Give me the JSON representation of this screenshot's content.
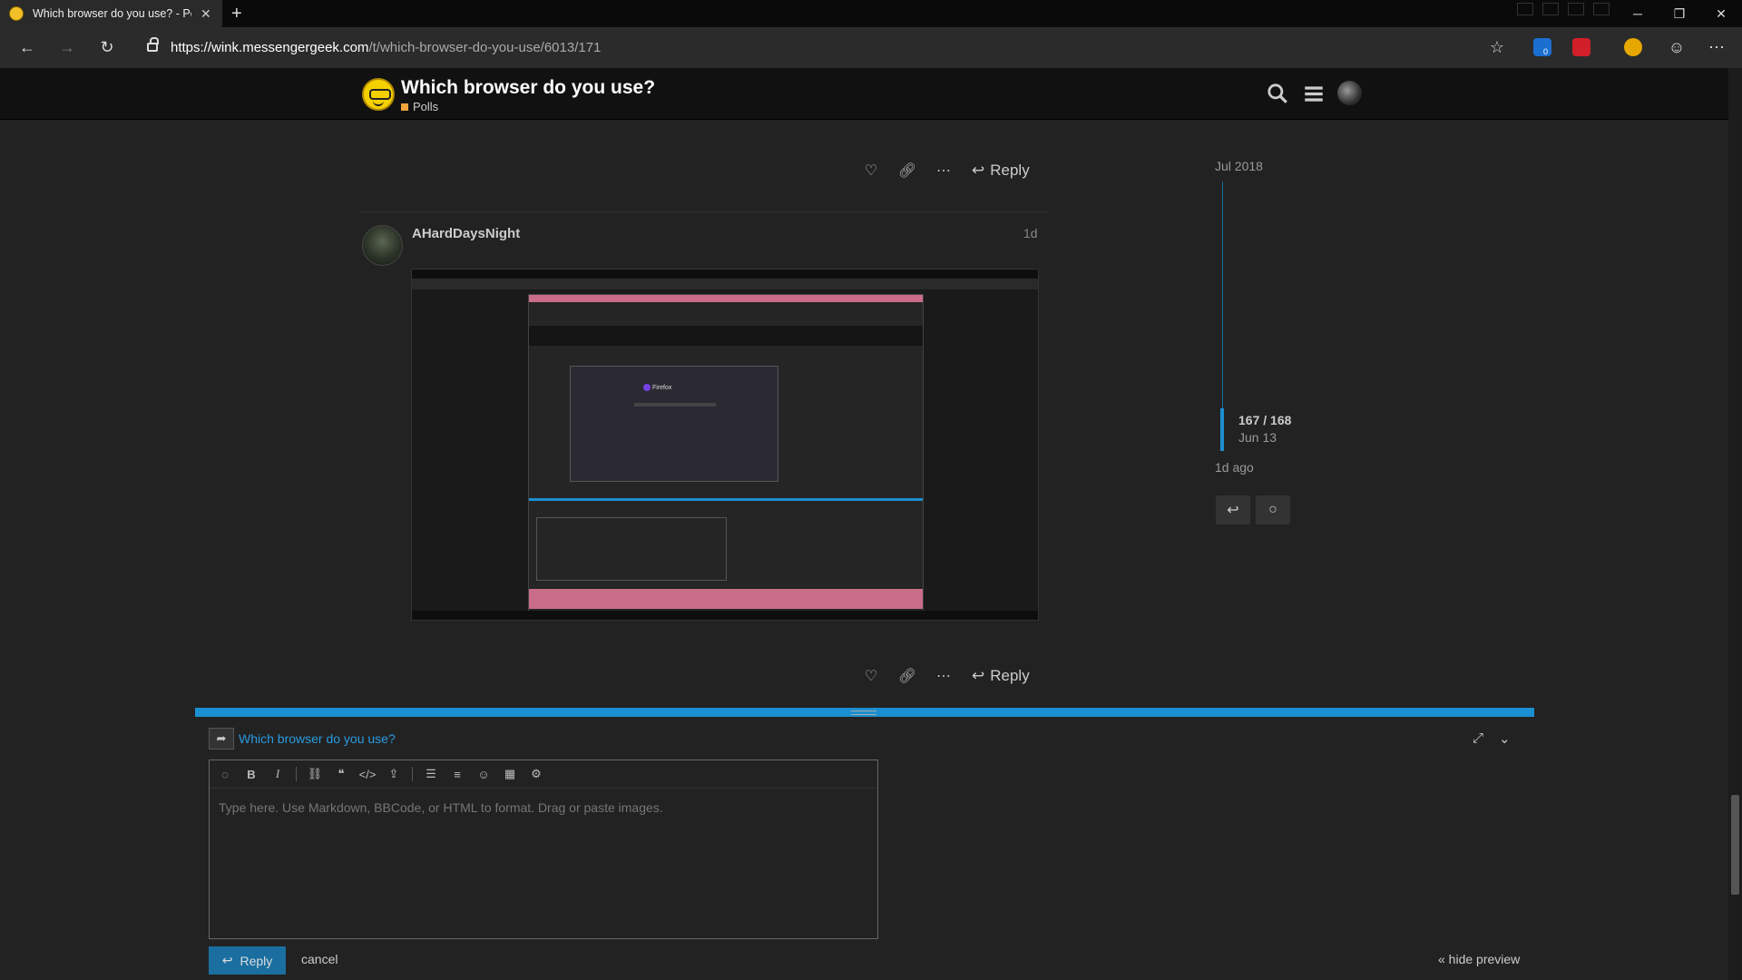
{
  "browser": {
    "tab_title": "Which browser do you use? - Polls",
    "url_host": "https://wink.messengergeek.com",
    "url_path": "/t/which-browser-do-you-use/6013/171",
    "ext_badge": "0"
  },
  "header": {
    "topic_title": "Which browser do you use?",
    "category": "Polls",
    "category_color": "#f1a33c"
  },
  "posts": [
    {
      "actions": {
        "reply_label": "Reply"
      }
    },
    {
      "username": "AHardDaysNight",
      "date": "1d",
      "image_alt": "Firefox",
      "actions": {
        "reply_label": "Reply"
      }
    }
  ],
  "timeline": {
    "start": "Jul 2018",
    "count": "167 / 168",
    "date": "Jun 13",
    "ago": "1d ago"
  },
  "composer": {
    "reply_to": "Which browser do you use?",
    "placeholder": "Type here. Use Markdown, BBCode, or HTML to format. Drag or paste images.",
    "reply_button": "Reply",
    "cancel": "cancel",
    "hide_preview": "« hide preview"
  },
  "colors": {
    "accent": "#1a8fd1",
    "background": "#222222"
  }
}
